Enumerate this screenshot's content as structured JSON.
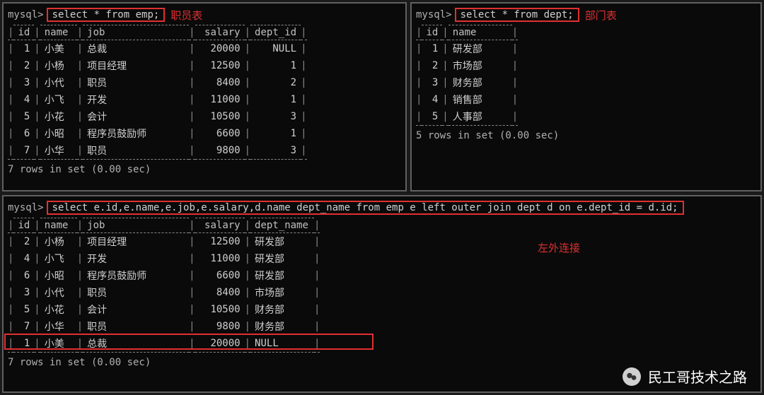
{
  "prompt": "mysql>",
  "emp": {
    "sql": "select * from emp;",
    "annotation": "职员表",
    "headers": [
      "id",
      "name",
      "job",
      "salary",
      "dept_id"
    ],
    "rows": [
      {
        "id": "1",
        "name": "小美",
        "job": "总裁",
        "salary": "20000",
        "dept_id": "NULL"
      },
      {
        "id": "2",
        "name": "小杨",
        "job": "项目经理",
        "salary": "12500",
        "dept_id": "1"
      },
      {
        "id": "3",
        "name": "小代",
        "job": "职员",
        "salary": "8400",
        "dept_id": "2"
      },
      {
        "id": "4",
        "name": "小飞",
        "job": "开发",
        "salary": "11000",
        "dept_id": "1"
      },
      {
        "id": "5",
        "name": "小花",
        "job": "会计",
        "salary": "10500",
        "dept_id": "3"
      },
      {
        "id": "6",
        "name": "小昭",
        "job": "程序员鼓励师",
        "salary": "6600",
        "dept_id": "1"
      },
      {
        "id": "7",
        "name": "小华",
        "job": "职员",
        "salary": "9800",
        "dept_id": "3"
      }
    ],
    "status": "7 rows in set (0.00 sec)"
  },
  "dept": {
    "sql": "select * from dept;",
    "annotation": "部门表",
    "headers": [
      "id",
      "name"
    ],
    "rows": [
      {
        "id": "1",
        "name": "研发部"
      },
      {
        "id": "2",
        "name": "市场部"
      },
      {
        "id": "3",
        "name": "财务部"
      },
      {
        "id": "4",
        "name": "销售部"
      },
      {
        "id": "5",
        "name": "人事部"
      }
    ],
    "status": "5 rows in set (0.00 sec)"
  },
  "join": {
    "sql": "select e.id,e.name,e.job,e.salary,d.name dept_name from emp e left outer join dept d on e.dept_id = d.id;",
    "annotation": "左外连接",
    "headers": [
      "id",
      "name",
      "job",
      "salary",
      "dept_name"
    ],
    "rows": [
      {
        "id": "2",
        "name": "小杨",
        "job": "项目经理",
        "salary": "12500",
        "dept_name": "研发部"
      },
      {
        "id": "4",
        "name": "小飞",
        "job": "开发",
        "salary": "11000",
        "dept_name": "研发部"
      },
      {
        "id": "6",
        "name": "小昭",
        "job": "程序员鼓励师",
        "salary": "6600",
        "dept_name": "研发部"
      },
      {
        "id": "3",
        "name": "小代",
        "job": "职员",
        "salary": "8400",
        "dept_name": "市场部"
      },
      {
        "id": "5",
        "name": "小花",
        "job": "会计",
        "salary": "10500",
        "dept_name": "财务部"
      },
      {
        "id": "7",
        "name": "小华",
        "job": "职员",
        "salary": "9800",
        "dept_name": "财务部"
      },
      {
        "id": "1",
        "name": "小美",
        "job": "总裁",
        "salary": "20000",
        "dept_name": "NULL"
      }
    ],
    "status": "7 rows in set (0.00 sec)"
  },
  "watermark": "民工哥技术之路"
}
